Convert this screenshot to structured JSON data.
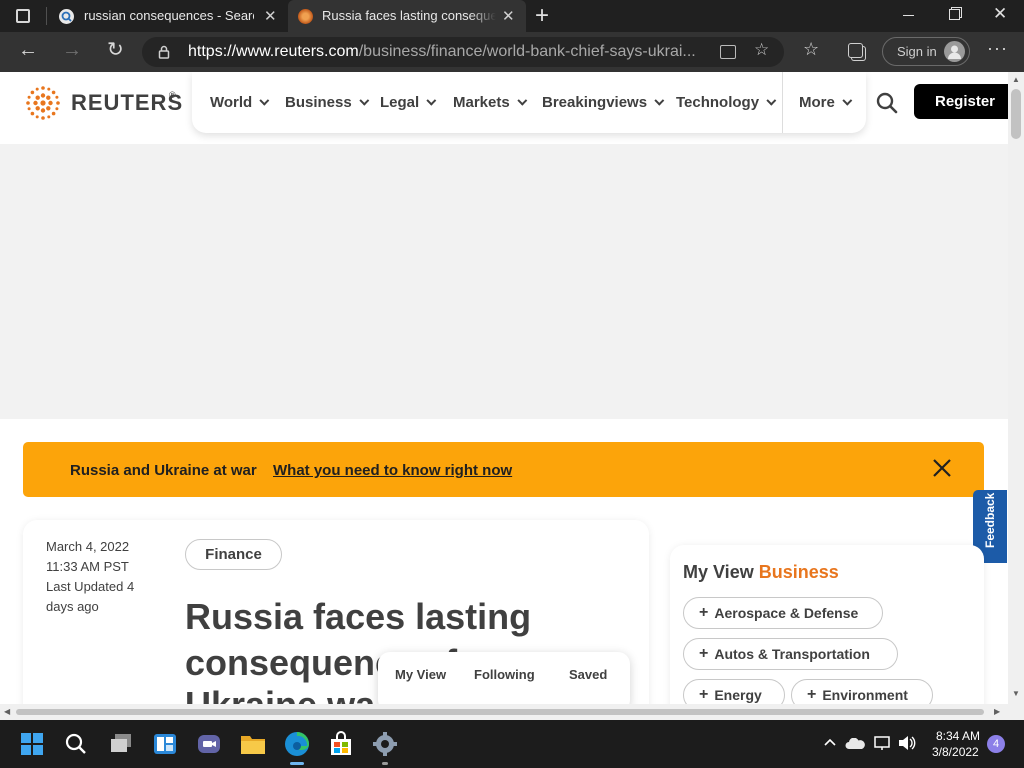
{
  "browser": {
    "tabs": [
      {
        "title": "russian consequences - Search",
        "icon": "search-favicon"
      },
      {
        "title": "Russia faces lasting consequences",
        "icon": "reuters-favicon"
      }
    ],
    "url_host": "https://www.reuters.com",
    "url_path": "/business/finance/world-bank-chief-says-ukrai...",
    "signin_label": "Sign in"
  },
  "site": {
    "brand": "REUTERS",
    "registered": "®",
    "nav": [
      "World",
      "Business",
      "Legal",
      "Markets",
      "Breakingviews",
      "Technology"
    ],
    "more_label": "More",
    "register_label": "Register"
  },
  "banner": {
    "title": "Russia and Ukraine at war",
    "link": "What you need to know right now"
  },
  "feedback_label": "Feedback",
  "article": {
    "date": "March 4, 2022",
    "time": "11:33 AM PST",
    "updated_line1": "Last Updated 4",
    "updated_line2": "days ago",
    "tag": "Finance",
    "headline_line1": "Russia faces lasting",
    "headline_line2": "consequences f",
    "headline_line3": "Ukraine wa"
  },
  "popup": {
    "tabs": [
      "My View",
      "Following",
      "Saved"
    ]
  },
  "myview": {
    "title": "My View",
    "section": "Business",
    "topics": [
      "Aerospace & Defense",
      "Autos & Transportation",
      "Energy",
      "Environment"
    ]
  },
  "taskbar": {
    "time": "8:34 AM",
    "date": "3/8/2022",
    "notifications": "4"
  },
  "colors": {
    "banner": "#fca40a",
    "brand_orange": "#e8761e",
    "register_bg": "#000000",
    "feedback": "#1c5ba8"
  }
}
